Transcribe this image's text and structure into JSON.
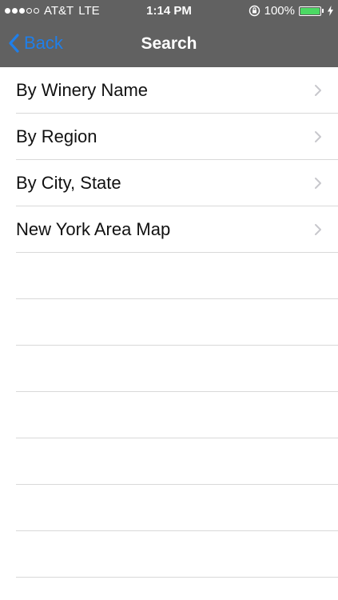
{
  "status_bar": {
    "carrier": "AT&T",
    "network": "LTE",
    "time": "1:14 PM",
    "battery_label": "100%",
    "battery_level": 1.0,
    "signal_bars_filled": 3,
    "signal_bars_total": 5
  },
  "nav": {
    "back_label": "Back",
    "title": "Search"
  },
  "menu": {
    "items": [
      {
        "label": "By Winery Name"
      },
      {
        "label": "By Region"
      },
      {
        "label": "By City, State"
      },
      {
        "label": "New York Area Map"
      }
    ]
  },
  "colors": {
    "nav_background": "#616161",
    "accent_blue": "#1f7fea",
    "battery_green": "#4cd964",
    "separator": "#d9d9d9",
    "chevron": "#c7c7cc"
  },
  "icons": {
    "back": "chevron-left-icon",
    "row_disclosure": "chevron-right-icon",
    "orientation_lock": "rotation-lock-icon",
    "battery": "battery-icon",
    "charging": "charging-bolt-icon"
  }
}
